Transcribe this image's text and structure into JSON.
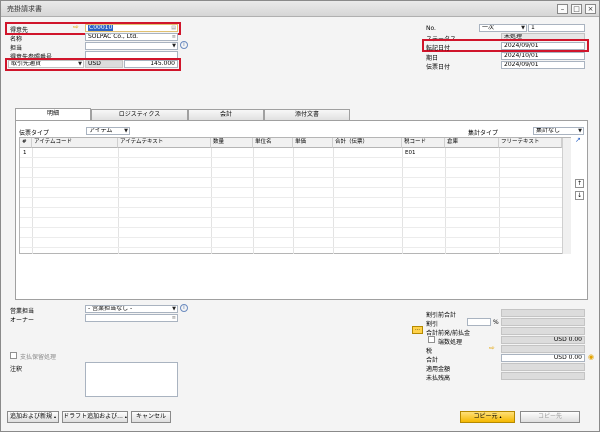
{
  "window": {
    "title": "売掛請求書"
  },
  "header_left": {
    "customer": {
      "label": "得意先",
      "value": "C00010"
    },
    "name": {
      "label": "名称",
      "value": "SOLPAC Co., Ltd."
    },
    "contact": {
      "label": "担当"
    },
    "customer_ref": {
      "label": "得意先参照番号"
    },
    "currency": {
      "label": "取引先通貨",
      "currency": "USD",
      "amount": "145.000"
    }
  },
  "header_right": {
    "no": {
      "label": "No.",
      "series": "一次",
      "value": "1"
    },
    "status": {
      "label": "ステータス",
      "value": "未処理"
    },
    "posting_date": {
      "label": "転記日付",
      "value": "2024/09/01"
    },
    "due_date": {
      "label": "期日",
      "value": "2024/10/01"
    },
    "document_date": {
      "label": "伝票日付",
      "value": "2024/09/01"
    }
  },
  "tabs": [
    "明細",
    "ロジスティクス",
    "会計",
    "添付文書"
  ],
  "content": {
    "doc_type_label": "伝票タイプ",
    "doc_type_value": "アイテム",
    "summary_type_label": "集計タイプ",
    "summary_type_value": "集計なし"
  },
  "grid": {
    "columns": [
      "#",
      "アイテムコード",
      "アイテムテキスト",
      "数量",
      "単位名",
      "単価",
      "合計（伝票）",
      "税コード",
      "倉庫",
      "フリーテキスト"
    ],
    "rows": [
      {
        "num": "1",
        "tax_code": "E01"
      }
    ]
  },
  "footer_left": {
    "sales_employee": {
      "label": "営業担当",
      "value": "- 営業担当なし -"
    },
    "owner": {
      "label": "オーナー"
    },
    "payment_block": {
      "label": "支払保留処理"
    },
    "remarks": {
      "label": "注釈"
    }
  },
  "footer_right": {
    "discount_before": {
      "label": "割引前合計"
    },
    "discount": {
      "label": "割引",
      "unit": "%"
    },
    "freight": {
      "label": "合計前発/前払金"
    },
    "rounding": {
      "label": "端数処理",
      "value": "USD 0.00"
    },
    "tax": {
      "label": "税"
    },
    "total": {
      "label": "合計",
      "value": "USD 0.00"
    },
    "applied": {
      "label": "適用金額"
    },
    "balance_due": {
      "label": "未払残高"
    }
  },
  "buttons": {
    "add_new": "追加および新規",
    "draft_add": "ドラフト追加および...",
    "cancel": "キャンセル",
    "copy_from": "コピー元",
    "copy_to": "コピー先"
  },
  "colors": {
    "highlight": "#d0152b",
    "accent_button": "#f5b800"
  }
}
